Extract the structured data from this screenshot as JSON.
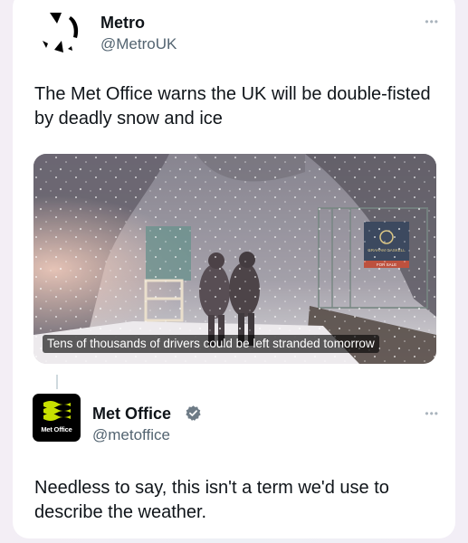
{
  "tweet1": {
    "name": "Metro",
    "handle": "@MetroUK",
    "more_label": "•••",
    "text": "The Met Office warns the UK will be double-fisted by deadly snow and ice",
    "media": {
      "caption": "Tens of thousands of drivers could be left stranded tomorrow",
      "sign_line1": "GRAHAM GASKELL",
      "sign_line2": "FOR SALE"
    }
  },
  "tweet2": {
    "name": "Met Office",
    "handle": "@metoffice",
    "more_label": "•••",
    "logo_text": "Met Office",
    "text": "Needless to say, this isn't a term we'd use to describe the weather."
  },
  "colors": {
    "text_primary": "#0f1419",
    "text_secondary": "#536471",
    "verified": "#6e7b86"
  },
  "icons": {
    "verified": "verified-badge-icon",
    "more": "more-options-icon"
  }
}
